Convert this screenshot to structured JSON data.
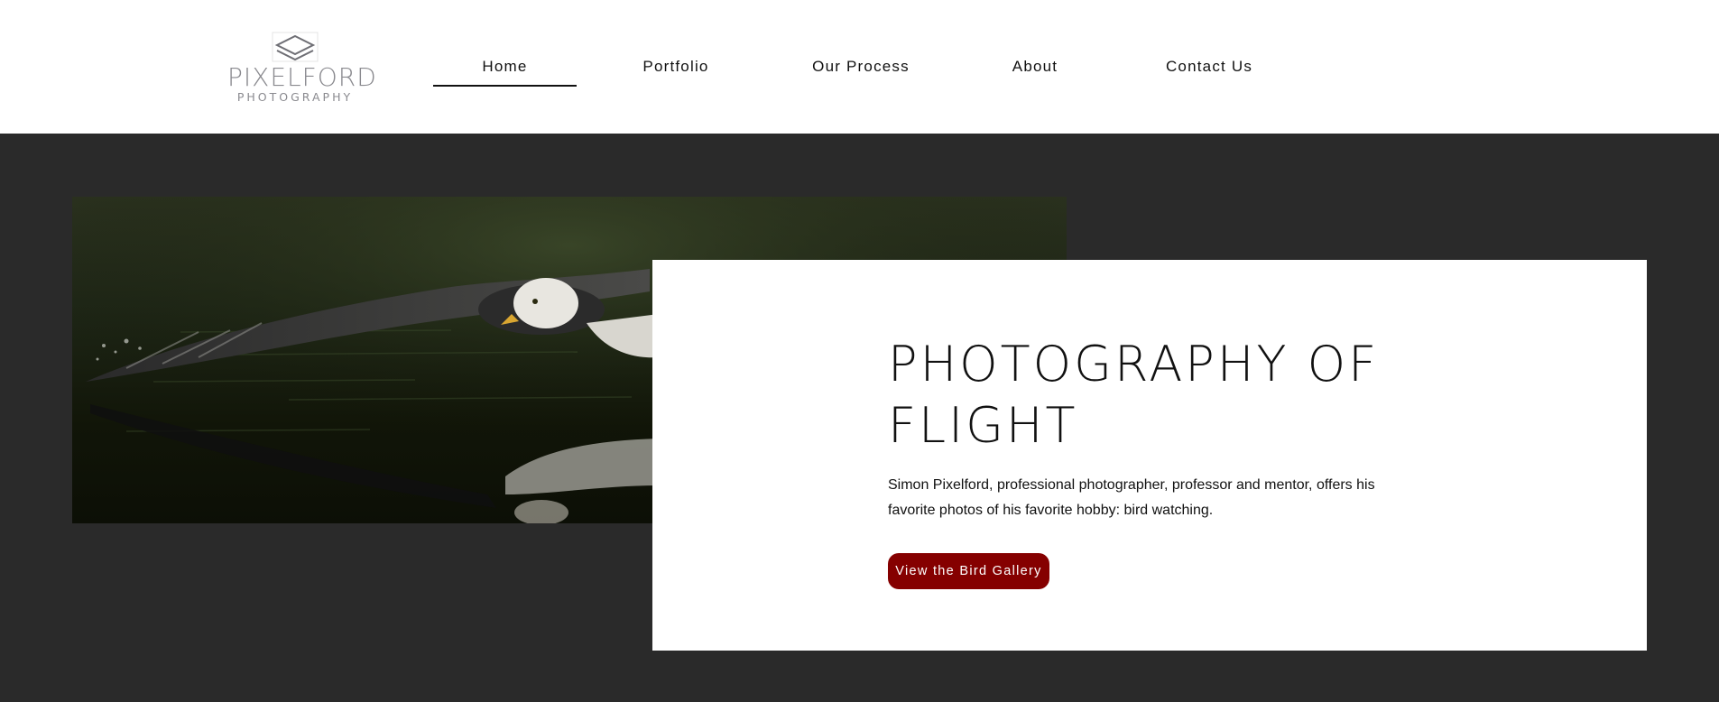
{
  "site": {
    "brand_name": "PIXELFORD",
    "brand_sub": "PHOTOGRAPHY",
    "accent_color": "#a83aa8"
  },
  "nav": {
    "items": [
      {
        "label": "Home",
        "active": true
      },
      {
        "label": "Portfolio",
        "active": false
      },
      {
        "label": "Our Process",
        "active": false
      },
      {
        "label": "About",
        "active": false
      },
      {
        "label": "Contact Us",
        "active": false
      }
    ]
  },
  "hero": {
    "background_color": "#2a2a2a",
    "image_subject": "bald eagle flying low over water with reflection",
    "title": "PHOTOGRAPHY OF FLIGHT",
    "description": "Simon Pixelford, professional photographer, professor and mentor, offers his favorite photos of his favorite hobby: bird watching.",
    "cta_label": "View the Bird Gallery",
    "cta_color": "#850000"
  },
  "icons": {
    "logo_mark": "diamond-logo-icon"
  }
}
